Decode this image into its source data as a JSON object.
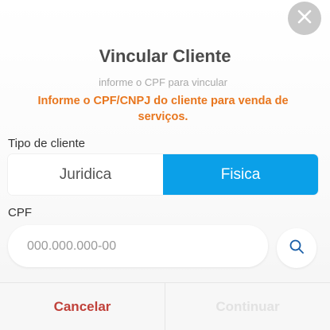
{
  "modal": {
    "title": "Vincular Cliente",
    "subtitle": "informe o CPF para vincular",
    "warning": "Informe o CPF/CNPJ do cliente para venda de serviços."
  },
  "client_type": {
    "label": "Tipo de cliente",
    "options": [
      "Juridica",
      "Fisica"
    ],
    "selected": "Fisica"
  },
  "cpf": {
    "label": "CPF",
    "value": "",
    "placeholder": "000.000.000-00"
  },
  "footer": {
    "cancel_label": "Cancelar",
    "continue_label": "Continuar"
  },
  "colors": {
    "accent": "#0ba0e8",
    "warning": "#e8761e",
    "cancel": "#c0413a",
    "disabled": "#e2e2e2"
  },
  "icons": {
    "close": "close-icon",
    "search": "search-icon"
  }
}
